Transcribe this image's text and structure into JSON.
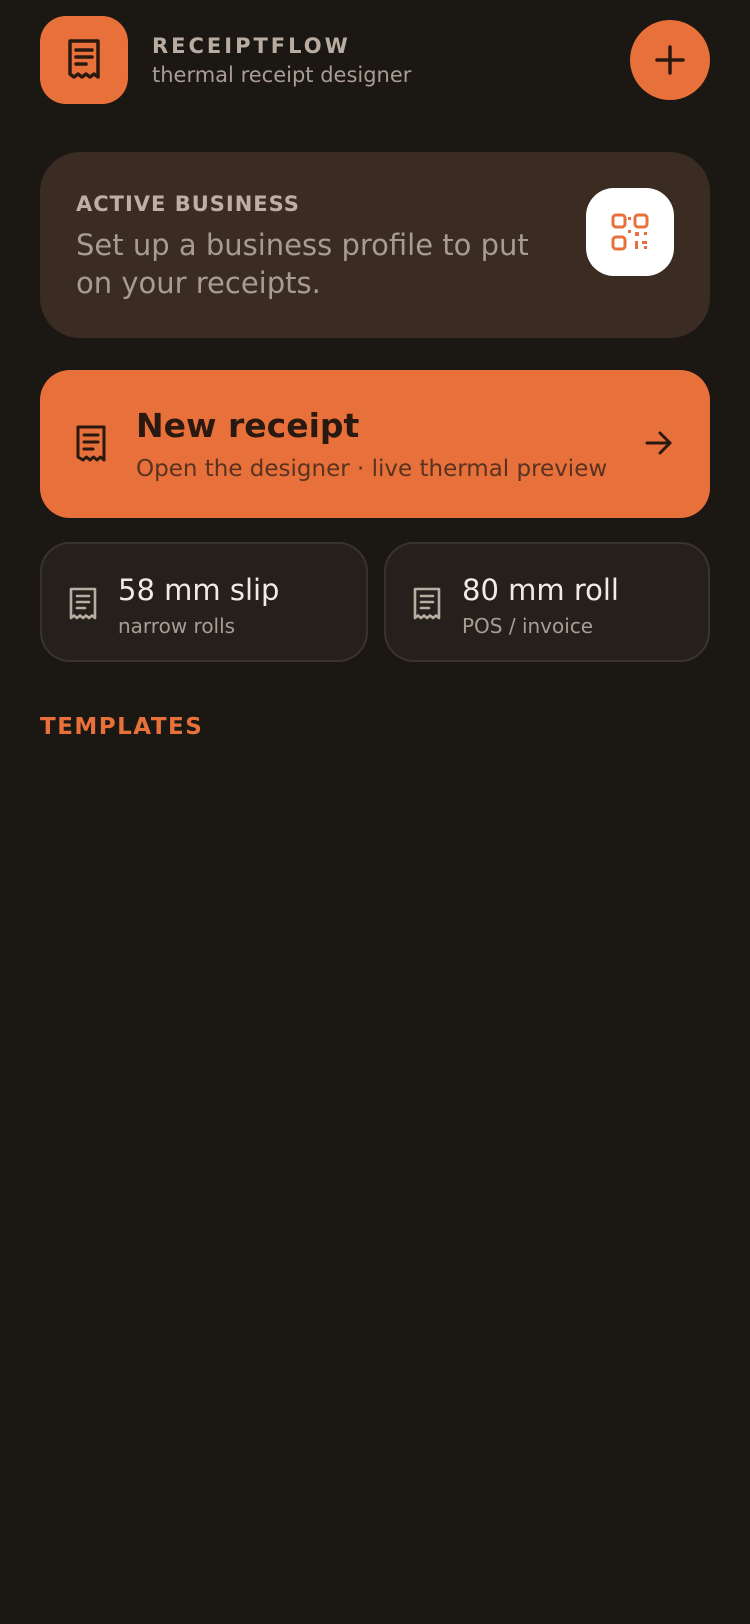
{
  "header": {
    "brand_name": "RECEIPTFLOW",
    "brand_tagline": "thermal receipt designer",
    "logo_icon": "receipt-icon",
    "add_icon": "plus-icon"
  },
  "active_business": {
    "label": "ACTIVE BUSINESS",
    "message": "Set up a business profile to put on your receipts.",
    "qr_icon": "qr-code-icon"
  },
  "new_receipt": {
    "title": "New receipt",
    "subtitle": "Open the designer · live thermal preview",
    "icon": "receipt-icon",
    "arrow_icon": "arrow-right-icon"
  },
  "sizes": [
    {
      "title": "58 mm slip",
      "subtitle": "narrow rolls",
      "icon": "receipt-icon"
    },
    {
      "title": "80 mm roll",
      "subtitle": "POS / invoice",
      "icon": "receipt-icon"
    }
  ],
  "templates": {
    "section_title": "TEMPLATES"
  },
  "colors": {
    "background": "#1b1713",
    "accent": "#e8703a",
    "card": "#3a2c22",
    "tile": "#25201c"
  }
}
